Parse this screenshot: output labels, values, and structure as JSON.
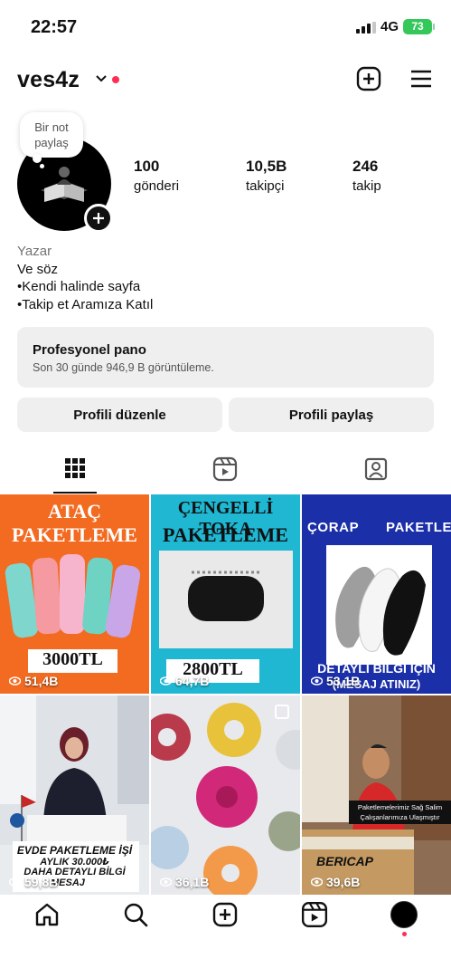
{
  "status_bar": {
    "time": "22:57",
    "network": "4G",
    "battery": "73"
  },
  "header": {
    "username": "ves4z"
  },
  "profile": {
    "note": "Bir not paylaş",
    "stats": [
      {
        "value": "100",
        "label": "gönderi"
      },
      {
        "value": "10,5B",
        "label": "takipçi"
      },
      {
        "value": "246",
        "label": "takip"
      }
    ],
    "bio": {
      "category": "Yazar",
      "lines": [
        "Ve söz",
        "•Kendi halinde sayfa",
        "•Takip et Aramıza Katıl"
      ]
    }
  },
  "dashboard": {
    "title": "Profesyonel pano",
    "subtitle": "Son 30 günde 946,9 B görüntüleme."
  },
  "buttons": {
    "edit": "Profili düzenle",
    "share": "Profili paylaş"
  },
  "tabs": [
    "grid-tab",
    "reels-tab",
    "tagged-tab"
  ],
  "posts": [
    {
      "views": "51,4B",
      "title1": "ATAÇ",
      "title2": "PAKETLEME",
      "price": "3000TL"
    },
    {
      "views": "64,7B",
      "title1": "ÇENGELLİ TOKA",
      "title2": "PAKETLEME",
      "price": "2800TL"
    },
    {
      "views": "53,1B",
      "title1": "ÇORAP",
      "title2": "PAKETLEME",
      "line1": "DETAYLI BİLGİ İÇİN",
      "line2": "(MESAJ ATINIZ)"
    },
    {
      "views": "59,8B",
      "line1": "EVDE PAKETLEME İŞİ",
      "line2": "AYLIK 30.000₺",
      "line3": "DAHA DETAYLI BİLGİ",
      "line4": "MESAJ"
    },
    {
      "views": "36,1B"
    },
    {
      "views": "39,6B",
      "caption": "Paketlemelerimiz Sağ Salim Çalışanlarımıza Ulaşmıştır",
      "brand": "BERICAP"
    }
  ],
  "colors": {
    "accent_red": "#ff2d55",
    "battery_green": "#34c759",
    "button_bg": "#efefef"
  }
}
